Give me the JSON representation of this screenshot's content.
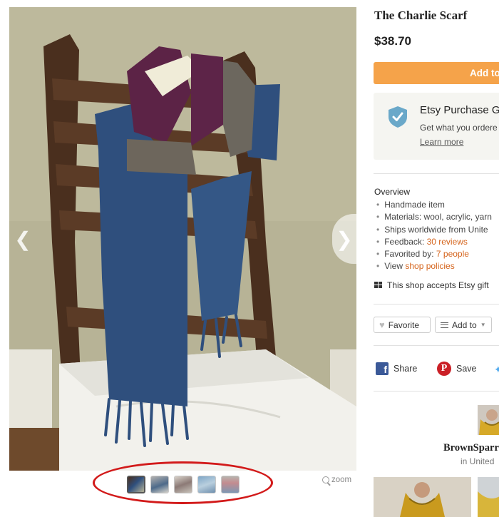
{
  "listing": {
    "title": "The Charlie Scarf",
    "price": "$38.70",
    "add_to_cart_label": "Add to"
  },
  "gallery": {
    "zoom_label": "zoom",
    "thumbnail_count": 5,
    "active_thumbnail": 1,
    "highlight_color": "#d21a1a"
  },
  "purchase_protection": {
    "title": "Etsy Purchase G",
    "subtitle": "Get what you ordere",
    "learn_more": "Learn more"
  },
  "overview": {
    "heading": "Overview",
    "items": [
      {
        "text": "Handmade item"
      },
      {
        "text": "Materials: wool, acrylic, yarn"
      },
      {
        "text": "Ships worldwide from Unite"
      },
      {
        "prefix": "Feedback: ",
        "link": "30 reviews"
      },
      {
        "prefix": "Favorited by: ",
        "link": "7 people"
      },
      {
        "prefix": "View ",
        "link": "shop policies"
      }
    ]
  },
  "gift_card_text": "This shop accepts Etsy gift",
  "actions": {
    "favorite": "Favorite",
    "add_to": "Add to"
  },
  "share": {
    "facebook": "Share",
    "pinterest": "Save"
  },
  "shop": {
    "name": "BrownSparr",
    "location": "in United"
  },
  "colors": {
    "accent": "#f5a34a",
    "link": "#d5641c",
    "facebook": "#3b5998",
    "pinterest": "#cb2027",
    "twitter": "#55acee"
  }
}
